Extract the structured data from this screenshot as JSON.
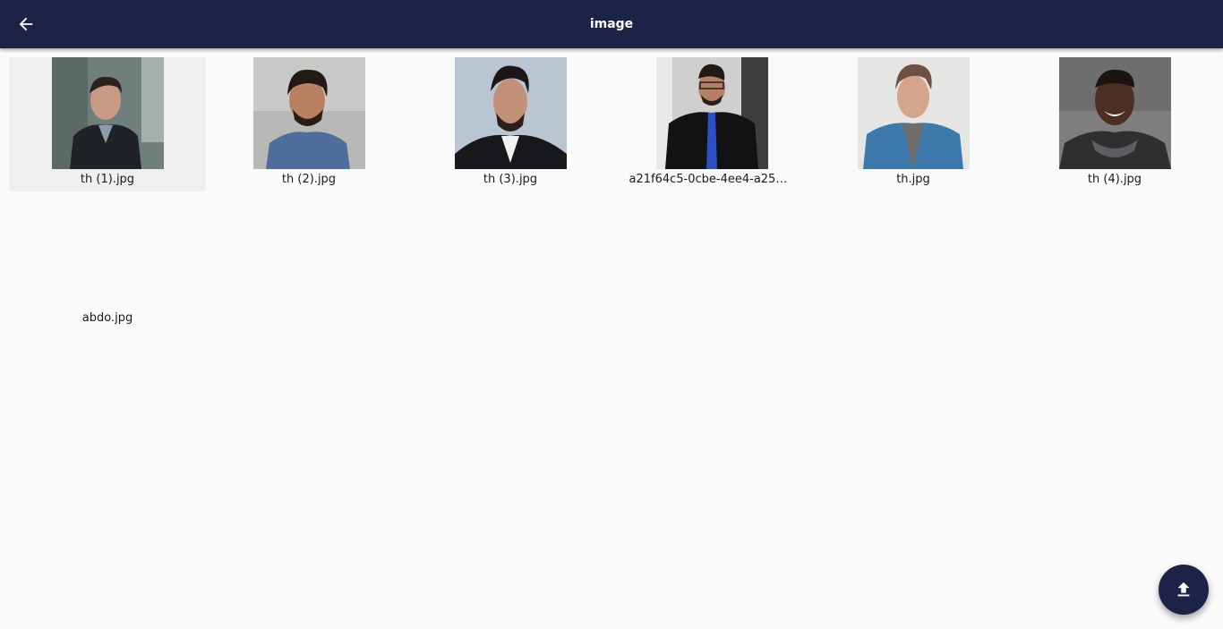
{
  "appbar": {
    "title": "image",
    "back_icon": "arrow-left-icon",
    "color": "#1c2347"
  },
  "files": [
    {
      "name": "th (1).jpg",
      "selected": true
    },
    {
      "name": "th (2).jpg",
      "selected": false
    },
    {
      "name": "th (3).jpg",
      "selected": false
    },
    {
      "name": "a21f64c5-0cbe-4ee4-a257-...",
      "selected": false
    },
    {
      "name": "th.jpg",
      "selected": false
    },
    {
      "name": "th (4).jpg",
      "selected": false
    },
    {
      "name": "abdo.jpg",
      "selected": false
    }
  ],
  "fab": {
    "icon": "upload-icon"
  }
}
